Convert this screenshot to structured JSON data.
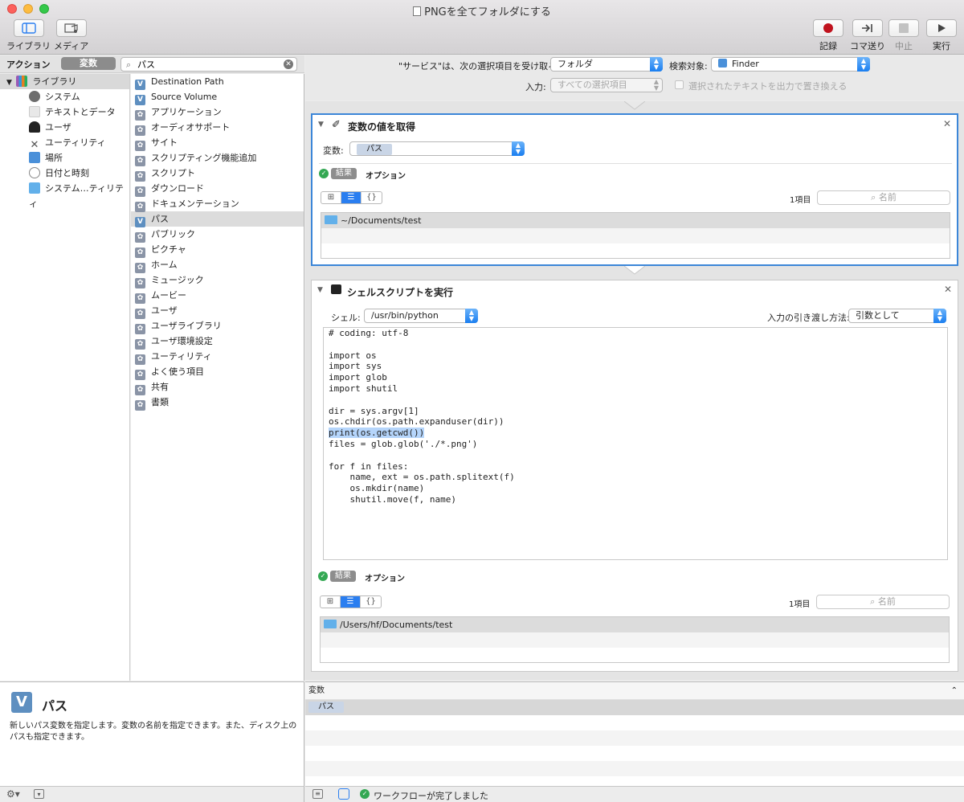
{
  "window": {
    "title": "PNGを全てフォルダにする"
  },
  "toolbar": {
    "library": "ライブラリ",
    "media": "メディア",
    "record": "記録",
    "step": "コマ送り",
    "stop": "中止",
    "run": "実行"
  },
  "leftbar": {
    "actions_tab": "アクション",
    "variables_tab": "変数",
    "search_value": "パス"
  },
  "library": {
    "root": "ライブラリ",
    "items": [
      "システム",
      "テキストとデータ",
      "ユーザ",
      "ユーティリティ",
      "場所",
      "日付と時刻",
      "システム…ティリティ"
    ]
  },
  "variables": [
    {
      "label": "Destination Path",
      "icon": "V"
    },
    {
      "label": "Source Volume",
      "icon": "V"
    },
    {
      "label": "アプリケーション",
      "icon": "gear"
    },
    {
      "label": "オーディオサポート",
      "icon": "gear"
    },
    {
      "label": "サイト",
      "icon": "gear"
    },
    {
      "label": "スクリプティング機能追加",
      "icon": "gear"
    },
    {
      "label": "スクリプト",
      "icon": "gear"
    },
    {
      "label": "ダウンロード",
      "icon": "gear"
    },
    {
      "label": "ドキュメンテーション",
      "icon": "gear"
    },
    {
      "label": "パス",
      "icon": "V"
    },
    {
      "label": "パブリック",
      "icon": "gear"
    },
    {
      "label": "ピクチャ",
      "icon": "gear"
    },
    {
      "label": "ホーム",
      "icon": "gear"
    },
    {
      "label": "ミュージック",
      "icon": "gear"
    },
    {
      "label": "ムービー",
      "icon": "gear"
    },
    {
      "label": "ユーザ",
      "icon": "gear"
    },
    {
      "label": "ユーザライブラリ",
      "icon": "gear"
    },
    {
      "label": "ユーザ環境設定",
      "icon": "gear"
    },
    {
      "label": "ユーティリティ",
      "icon": "gear"
    },
    {
      "label": "よく使う項目",
      "icon": "gear"
    },
    {
      "label": "共有",
      "icon": "gear"
    },
    {
      "label": "書類",
      "icon": "gear"
    }
  ],
  "description": {
    "title": "パス",
    "text": "新しいパス変数を指定します。変数の名前を指定できます。また、ディスク上のパスも指定できます。"
  },
  "service": {
    "receives_label": "\"サービス\"は、次の選択項目を受け取る:",
    "receives_value": "フォルダ",
    "in_label": "検索対象:",
    "in_value": "Finder",
    "input_label": "入力:",
    "input_value": "すべての選択項目",
    "replace_label": "選択されたテキストを出力で置き換える"
  },
  "action1": {
    "title": "変数の値を取得",
    "var_label": "変数:",
    "var_value": "パス",
    "results": "結果",
    "options": "オプション",
    "count": "1項目",
    "search_placeholder": "名前",
    "result_item": "~/Documents/test"
  },
  "action2": {
    "title": "シェルスクリプトを実行",
    "shell_label": "シェル:",
    "shell_value": "/usr/bin/python",
    "pass_label": "入力の引き渡し方法:",
    "pass_value": "引数として",
    "code_lines": [
      "# coding: utf-8",
      "",
      "import os",
      "import sys",
      "import glob",
      "import shutil",
      "",
      "dir = sys.argv[1]",
      "os.chdir(os.path.expanduser(dir))",
      "print(os.getcwd())",
      "files = glob.glob('./*.png')",
      "",
      "for f in files:",
      "    name, ext = os.path.splitext(f)",
      "    os.mkdir(name)",
      "    shutil.move(f, name)"
    ],
    "results": "結果",
    "options": "オプション",
    "count": "1項目",
    "search_placeholder": "名前",
    "result_item": "/Users/hf/Documents/test"
  },
  "varpanel": {
    "header": "変数",
    "token": "パス"
  },
  "status": {
    "text": "ワークフローが完了しました"
  },
  "colors": {
    "accent": "#2a7ef0",
    "record": "#c0121d",
    "success": "#34a853"
  }
}
